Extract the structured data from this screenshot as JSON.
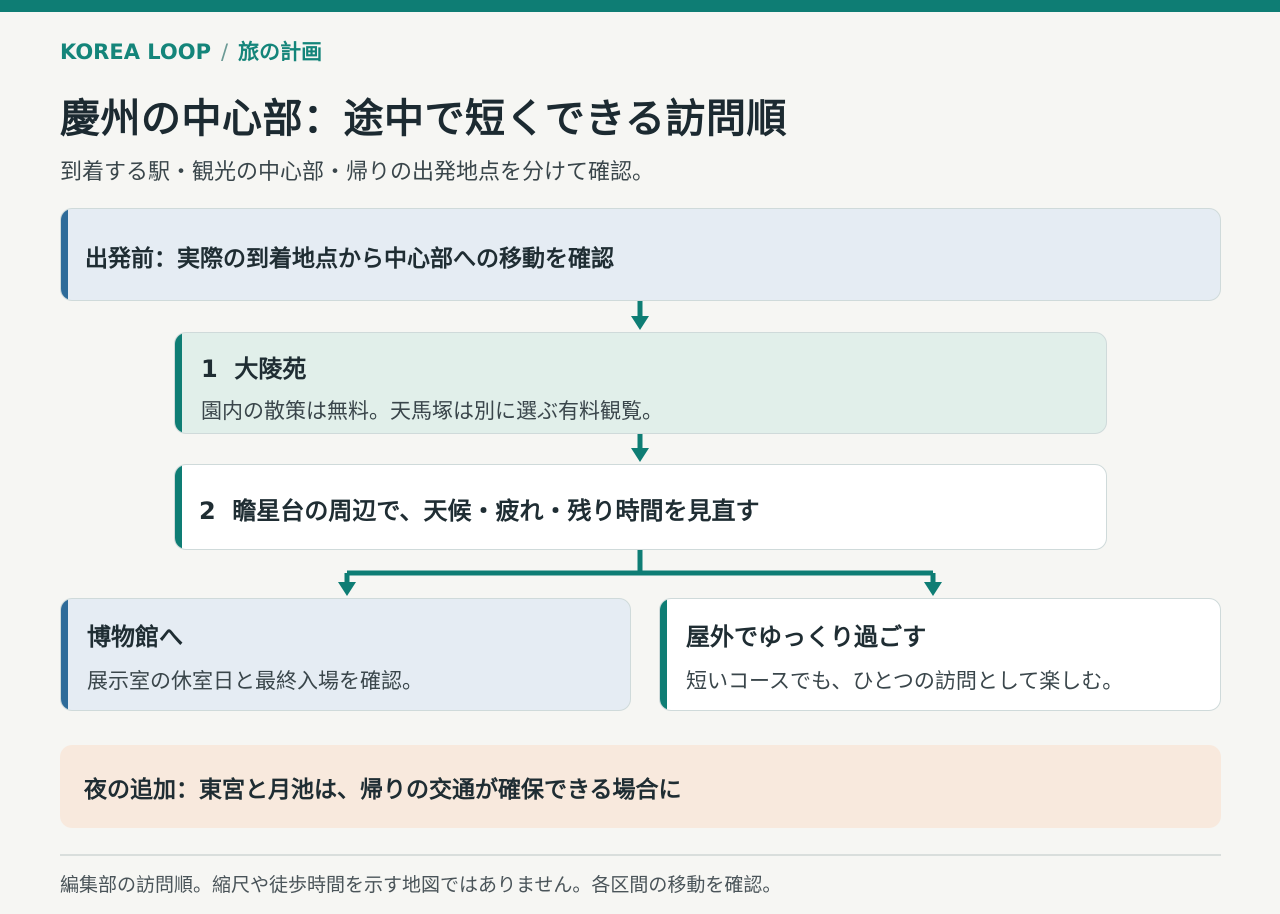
{
  "breadcrumb": {
    "site": "KOREA LOOP",
    "separator": "/",
    "section": "旅の計画"
  },
  "title": "慶州の中心部：途中で短くできる訪問順",
  "subtitle": "到着する駅・観光の中心部・帰りの出発地点を分けて確認。",
  "flow": {
    "pre": "出発前：実際の到着地点から中心部への移動を確認",
    "step1": {
      "number": "1",
      "name": "大陵苑",
      "description": "園内の散策は無料。天馬塚は別に選ぶ有料観覧。"
    },
    "step2": {
      "number": "2",
      "name": "瞻星台の周辺で、天候・疲れ・残り時間を見直す"
    },
    "branch_left": {
      "name": "博物館へ",
      "description": "展示室の休室日と最終入場を確認。"
    },
    "branch_right": {
      "name": "屋外でゆっくり過ごす",
      "description": "短いコースでも、ひとつの訪問として楽しむ。"
    },
    "night": "夜の追加：東宮と月池は、帰りの交通が確保できる場合に"
  },
  "footnote": "編集部の訪問順。縮尺や徒歩時間を示す地図ではありません。各区間の移動を確認。",
  "colors": {
    "accent": "#0e7d74",
    "blue": "#2e6b99",
    "pre_bg": "#e5ecf3",
    "step1_bg": "#e1efea",
    "night_bg": "#f8e9dd"
  }
}
